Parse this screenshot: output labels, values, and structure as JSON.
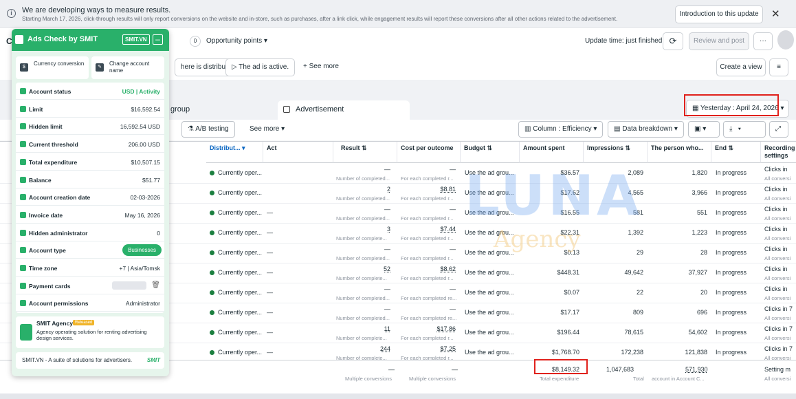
{
  "notice": {
    "title": "We are developing ways to measure results.",
    "body": "Starting March 17, 2026, click-through results will only report conversions on the website and in-store, such as purchases, after a link click, while engagement results will report these conversions after all other actions related to the advertisement.",
    "button": "Introduction to this update",
    "close": "✕"
  },
  "top": {
    "account_letter": "C",
    "opportunity_count": "0",
    "opportunity_label": "Opportunity points",
    "update_time": "Update time: just finished",
    "review_button": "Review and post",
    "more": "···"
  },
  "filters": {
    "chip1": "here is distribution",
    "chip2": "The ad is active.",
    "see_more": "See more",
    "create_view": "Create a view"
  },
  "tabs": {
    "group": "group",
    "advertisement": "Advertisement",
    "date": "Yesterday : April 24, 2026"
  },
  "toolbar": {
    "ab": "A/B testing",
    "see_more": "See more",
    "column": "Column : Efficiency",
    "breakdown": "Data breakdown"
  },
  "columns": {
    "distribution": "Distribut...",
    "act": "Act",
    "result": "Result",
    "cost": "Cost per outcome",
    "budget": "Budget",
    "amount": "Amount spent",
    "impressions": "Impressions",
    "person": "The person who...",
    "end": "End",
    "recording": "Recording settings"
  },
  "rows": [
    {
      "status": "Currently oper...",
      "act": "",
      "result": "—",
      "result_sub": "Number of completed...",
      "cost": "—",
      "cost_sub": "For each completed r...",
      "budget": "Use the ad grou...",
      "amount": "$36.57",
      "impressions": "2,089",
      "person": "1,820",
      "end": "In progress",
      "rec": "Clicks in",
      "rec_sub": "All conversi"
    },
    {
      "status": "Currently oper...",
      "act": "",
      "result": "2",
      "result_sub": "Number of completed...",
      "cost": "$8.81",
      "cost_sub": "For each completed r...",
      "budget": "Use the ad grou...",
      "amount": "$17.62",
      "impressions": "4,565",
      "person": "3,966",
      "end": "In progress",
      "rec": "Clicks in",
      "rec_sub": "All conversi"
    },
    {
      "status": "Currently oper...",
      "act": "—",
      "result": "—",
      "result_sub": "Number of completed...",
      "cost": "—",
      "cost_sub": "For each completed r...",
      "budget": "Use the ad grou...",
      "amount": "$16.55",
      "impressions": "581",
      "person": "551",
      "end": "In progress",
      "rec": "Clicks in",
      "rec_sub": "All conversi"
    },
    {
      "status": "Currently oper...",
      "act": "—",
      "result": "3",
      "result_sub": "Number of complete...",
      "cost": "$7.44",
      "cost_sub": "For each completed r...",
      "budget": "Use the ad grou...",
      "amount": "$22.31",
      "impressions": "1,392",
      "person": "1,223",
      "end": "In progress",
      "rec": "Clicks in",
      "rec_sub": "All conversi"
    },
    {
      "status": "Currently oper...",
      "act": "—",
      "result": "—",
      "result_sub": "Number of completed...",
      "cost": "—",
      "cost_sub": "For each completed r...",
      "budget": "Use the ad grou...",
      "amount": "$0.13",
      "impressions": "29",
      "person": "28",
      "end": "In progress",
      "rec": "Clicks in",
      "rec_sub": "All conversi"
    },
    {
      "status": "Currently oper...",
      "act": "—",
      "result": "52",
      "result_sub": "Number of complete...",
      "cost": "$8.62",
      "cost_sub": "For each completed r...",
      "budget": "Use the ad grou...",
      "amount": "$448.31",
      "impressions": "49,642",
      "person": "37,927",
      "end": "In progress",
      "rec": "Clicks in",
      "rec_sub": "All conversi"
    },
    {
      "status": "Currently oper...",
      "act": "—",
      "result": "—",
      "result_sub": "Number of completed...",
      "cost": "—",
      "cost_sub": "For each completed re...",
      "budget": "Use the ad grou...",
      "amount": "$0.07",
      "impressions": "22",
      "person": "20",
      "end": "In progress",
      "rec": "Clicks in",
      "rec_sub": "All conversi"
    },
    {
      "status": "Currently oper...",
      "act": "—",
      "result": "—",
      "result_sub": "Number of completed...",
      "cost": "—",
      "cost_sub": "For each completed re...",
      "budget": "Use the ad grou...",
      "amount": "$17.17",
      "impressions": "809",
      "person": "696",
      "end": "In progress",
      "rec": "Clicks in 7",
      "rec_sub": "All conversi"
    },
    {
      "status": "Currently oper...",
      "act": "—",
      "result": "11",
      "result_sub": "Number of complete...",
      "cost": "$17.86",
      "cost_sub": "For each completed r...",
      "budget": "Use the ad grou...",
      "amount": "$196.44",
      "impressions": "78,615",
      "person": "54,602",
      "end": "In progress",
      "rec": "Clicks in 7",
      "rec_sub": "All conversi"
    },
    {
      "status": "Currently oper...",
      "act": "—",
      "result": "244",
      "result_sub": "Number of complete...",
      "cost": "$7.25",
      "cost_sub": "For each completed r...",
      "budget": "Use the ad grou...",
      "amount": "$1,768.70",
      "impressions": "172,238",
      "person": "121,838",
      "end": "In progress",
      "rec": "Clicks in 7",
      "rec_sub": "All conversi"
    }
  ],
  "totals": {
    "result": "—",
    "result_sub": "Multiple conversions",
    "cost": "—",
    "cost_sub": "Multiple conversions",
    "amount": "$8,149.32",
    "amount_sub": "Total expenditure",
    "impressions": "1,047,683",
    "impressions_sub": "Total",
    "person": "571,930",
    "person_sub": "account in Account C...",
    "rec": "Setting m",
    "rec_sub": "All conversi"
  },
  "watermark": {
    "big": "LUNA",
    "small": "Agency"
  },
  "panel": {
    "title": "Ads Check by SMIT",
    "badge": "SMIT.VN",
    "minimize": "–",
    "btn_currency": "Currency conversion",
    "btn_change": "Change account name",
    "items": [
      {
        "k": "Account status",
        "v": "USD | Activity"
      },
      {
        "k": "Limit",
        "v": "$16,592.54"
      },
      {
        "k": "Hidden limit",
        "v": "16,592.54 USD"
      },
      {
        "k": "Current threshold",
        "v": "206.00 USD"
      },
      {
        "k": "Total expenditure",
        "v": "$10,507.15"
      },
      {
        "k": "Balance",
        "v": "$51.77"
      },
      {
        "k": "Account creation date",
        "v": "02-03-2026"
      },
      {
        "k": "Invoice date",
        "v": "May 16, 2026"
      },
      {
        "k": "Hidden administrator",
        "v": "0"
      },
      {
        "k": "Account type",
        "v": "Businesses"
      },
      {
        "k": "Time zone",
        "v": "+7 | Asia/Tomsk"
      },
      {
        "k": "Payment cards",
        "v": ""
      },
      {
        "k": "Account permissions",
        "v": "Administrator"
      }
    ],
    "promo_title": "SMIT Agency",
    "promo_badge": "Released",
    "promo_text": "Agency operating solution for renting advertising design services.",
    "footer": "SMIT.VN - A suite of solutions for advertisers.",
    "footer_logo": "SMIT"
  },
  "colors": {
    "accent": "#29b06a",
    "highlight": "#e0211c",
    "status": "#1b7f3f"
  }
}
